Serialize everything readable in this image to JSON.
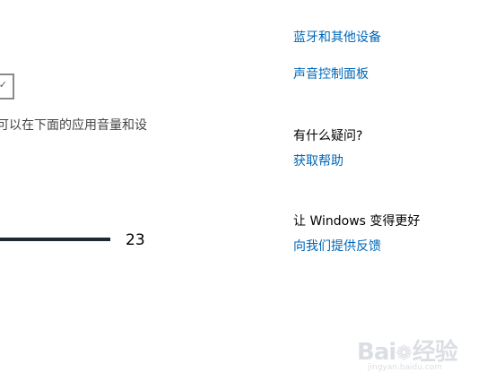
{
  "right_panel": {
    "links_top": [
      {
        "label": "蓝牙和其他设备"
      },
      {
        "label": "声音控制面板"
      }
    ],
    "help": {
      "heading": "有什么疑问?",
      "link": "获取帮助"
    },
    "feedback": {
      "heading": "让 Windows 变得更好",
      "link": "向我们提供反馈"
    }
  },
  "left_panel": {
    "dropdown": {
      "chevron_icon": "chevron-down-icon"
    },
    "description": "可以在下面的应用音量和设",
    "volume": {
      "value": "23"
    }
  },
  "watermark": {
    "brand": "Bai",
    "paw_icon": "paw-icon",
    "suffix": "经验",
    "url": "jingyan.baidu.com"
  },
  "colors": {
    "link": "#0067b8",
    "slider": "#1e2a33"
  }
}
